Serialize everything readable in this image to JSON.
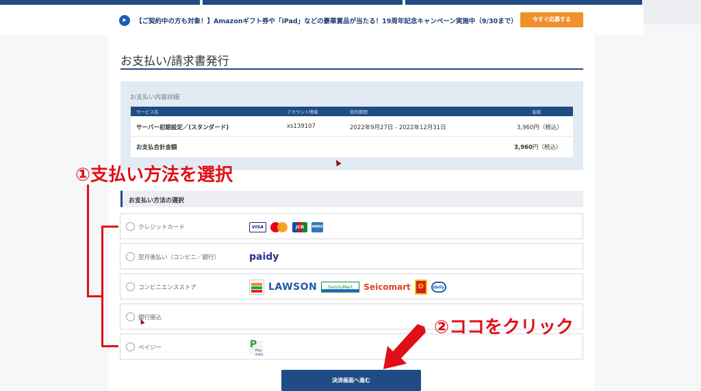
{
  "notice": {
    "icon": "megaphone-icon",
    "text": "【ご契約中の方も対象！】Amazonギフト券や「iPad」などの豪華賞品が当たる！19周年記念キャンペーン実施中（9/30まで）",
    "cta_label": "今すぐ応募する"
  },
  "page": {
    "title": "お支払い/請求書発行"
  },
  "summary": {
    "section_title": "お支払い内容詳細",
    "columns": [
      "サービス名",
      "アカウント情報",
      "契約期間",
      "金額"
    ],
    "rows": [
      {
        "service": "サーバー初期設定／(スタンダード)",
        "account": "xs139107",
        "period": "2022年9月27日 - 2022年12月31日",
        "amount": "3,960円（税込）"
      }
    ],
    "total_label": "お支払合計金額",
    "total_amount": "3,960",
    "total_suffix": "円（税込）"
  },
  "payment": {
    "section_title": "お支払い方法の選択",
    "options": [
      {
        "label": "クレジットカード",
        "logos": [
          "VISA",
          "Mastercard",
          "JCB",
          "AMEX"
        ]
      },
      {
        "label": "翌月後払い（コンビニ／銀行）",
        "logos": [
          "paidy"
        ]
      },
      {
        "label": "コンビニエンスストア",
        "logos": [
          "7",
          "LAWSON",
          "FamilyMart",
          "Seicomart",
          "D",
          "daily"
        ]
      },
      {
        "label": "銀行振込",
        "logos": []
      },
      {
        "label": "ペイジー",
        "logos": [
          "P",
          "Pay-easy"
        ]
      }
    ]
  },
  "submit": {
    "label": "決済画面へ進む"
  },
  "annotations": {
    "step1": "①支払い方法を選択",
    "step2": "②ココをクリック",
    "color": "#e10e17"
  },
  "colors": {
    "brand": "#1f4c84",
    "cta": "#f0902a"
  }
}
